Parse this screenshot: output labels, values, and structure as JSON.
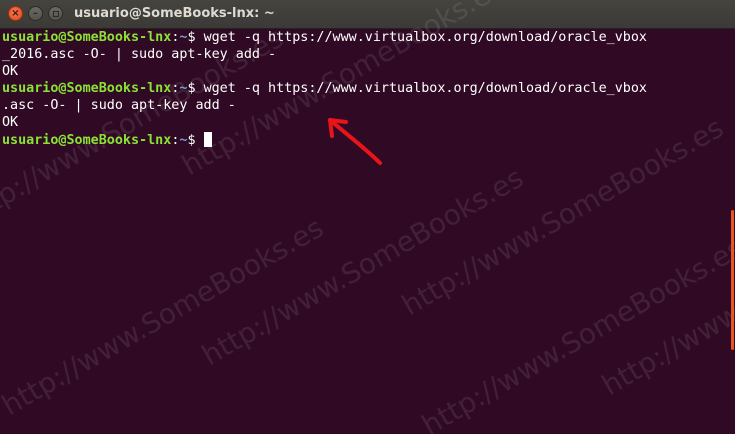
{
  "window": {
    "title": "usuario@SomeBooks-lnx: ~"
  },
  "colors": {
    "background": "#300a24",
    "prompt_user": "#8ae234",
    "prompt_path": "#729fcf",
    "arrow": "#e8141a",
    "scrollbar": "#e95420"
  },
  "terminal": {
    "lines": [
      {
        "user": "usuario@SomeBooks-lnx",
        "sep": ":",
        "path": "~",
        "symbol": "$ ",
        "command": "wget -q https://www.virtualbox.org/download/oracle_vbox"
      },
      {
        "text": "_2016.asc -O- | sudo apt-key add -"
      },
      {
        "text": "OK"
      },
      {
        "user": "usuario@SomeBooks-lnx",
        "sep": ":",
        "path": "~",
        "symbol": "$ ",
        "command": "wget -q https://www.virtualbox.org/download/oracle_vbox"
      },
      {
        "text": ".asc -O- | sudo apt-key add -"
      },
      {
        "text": "OK"
      },
      {
        "user": "usuario@SomeBooks-lnx",
        "sep": ":",
        "path": "~",
        "symbol": "$ ",
        "command": ""
      }
    ]
  },
  "watermark": "http://www.SomeBooks.es"
}
